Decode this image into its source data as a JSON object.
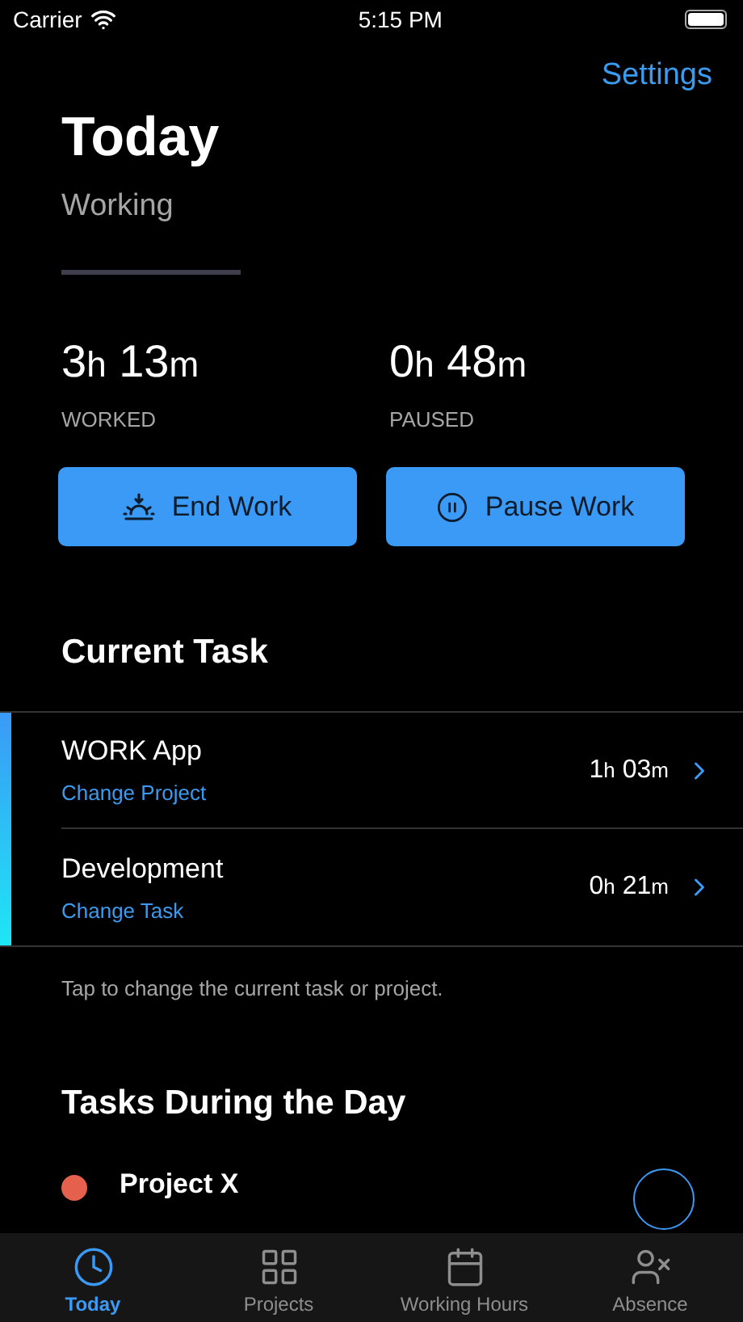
{
  "status_bar": {
    "carrier": "Carrier",
    "time": "5:15 PM"
  },
  "settings_link": "Settings",
  "title": "Today",
  "status": "Working",
  "stats": [
    {
      "parts": [
        "3",
        "h",
        " 13",
        "m"
      ],
      "label": "WORKED"
    },
    {
      "parts": [
        "0",
        "h",
        " 48",
        "m"
      ],
      "label": "PAUSED"
    }
  ],
  "actions": [
    {
      "kind": "end",
      "label": "End Work"
    },
    {
      "kind": "pause",
      "label": "Pause Work"
    }
  ],
  "current_task": {
    "heading": "Current Task",
    "rows": [
      {
        "name": "WORK App",
        "action": "Change Project",
        "duration": [
          "1",
          "h",
          " 03",
          "m"
        ]
      },
      {
        "name": "Development",
        "action": "Change Task",
        "duration": [
          "0",
          "h",
          " 21",
          "m"
        ]
      }
    ],
    "hint": "Tap to change the current task or project."
  },
  "day_tasks": {
    "heading": "Tasks During the Day",
    "rows": [
      {
        "name": "Project X",
        "color": "#e5604d"
      }
    ]
  },
  "tabs": [
    {
      "kind": "today",
      "label": "Today",
      "selected": true
    },
    {
      "kind": "projects",
      "label": "Projects",
      "selected": false
    },
    {
      "kind": "hours",
      "label": "Working Hours",
      "selected": false
    },
    {
      "kind": "absence",
      "label": "Absence",
      "selected": false
    }
  ]
}
